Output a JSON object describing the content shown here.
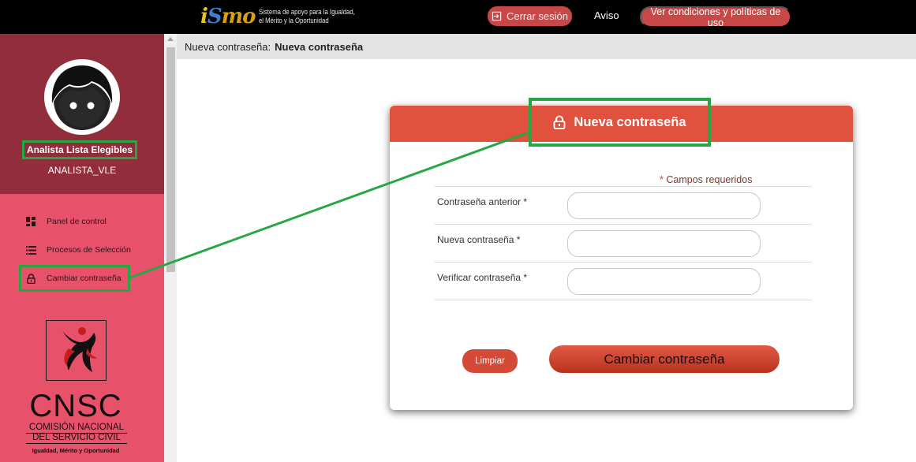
{
  "header": {
    "logo_text": "iSmo",
    "tagline_line1": "Sistema de apoyo para la Igualdad,",
    "tagline_line2": "el Mérito y la Oportunidad",
    "logout_label": "Cerrar sesión",
    "notice_label": "Aviso",
    "terms_label": "Ver condiciones y políticas de uso",
    "logout_icon": "sign-out-icon"
  },
  "sidebar": {
    "user_role": "Analista Lista Elegibles",
    "username": "ANALISTA_VLE",
    "items": [
      {
        "label": "Panel de control",
        "icon": "dashboard-icon"
      },
      {
        "label": "Procesos de Selección",
        "icon": "list-icon"
      },
      {
        "label": "Cambiar contraseña",
        "icon": "lock-icon"
      }
    ],
    "org_acronym": "CNSC",
    "org_name_line1": "COMISIÓN NACIONAL",
    "org_name_line2": "DEL SERVICIO CIVIL",
    "org_motto": "Igualdad, Mérito y Oportunidad"
  },
  "breadcrumb": {
    "parent": "Nueva contraseña:",
    "current": "Nueva contraseña"
  },
  "form": {
    "title": "Nueva contraseña",
    "required_note": "Campos requeridos",
    "required_mark": "*",
    "fields": [
      {
        "label": "Contraseña anterior *",
        "value": ""
      },
      {
        "label": "Nueva contraseña *",
        "value": ""
      },
      {
        "label": "Verificar contraseña *",
        "value": ""
      }
    ],
    "clear_label": "Limpiar",
    "submit_label": "Cambiar contraseña"
  },
  "colors": {
    "topbar": "#000000",
    "sidebar_profile": "#922d3c",
    "sidebar": "#e8516a",
    "accent_red": "#e0513e",
    "highlight_green": "#27a644"
  }
}
